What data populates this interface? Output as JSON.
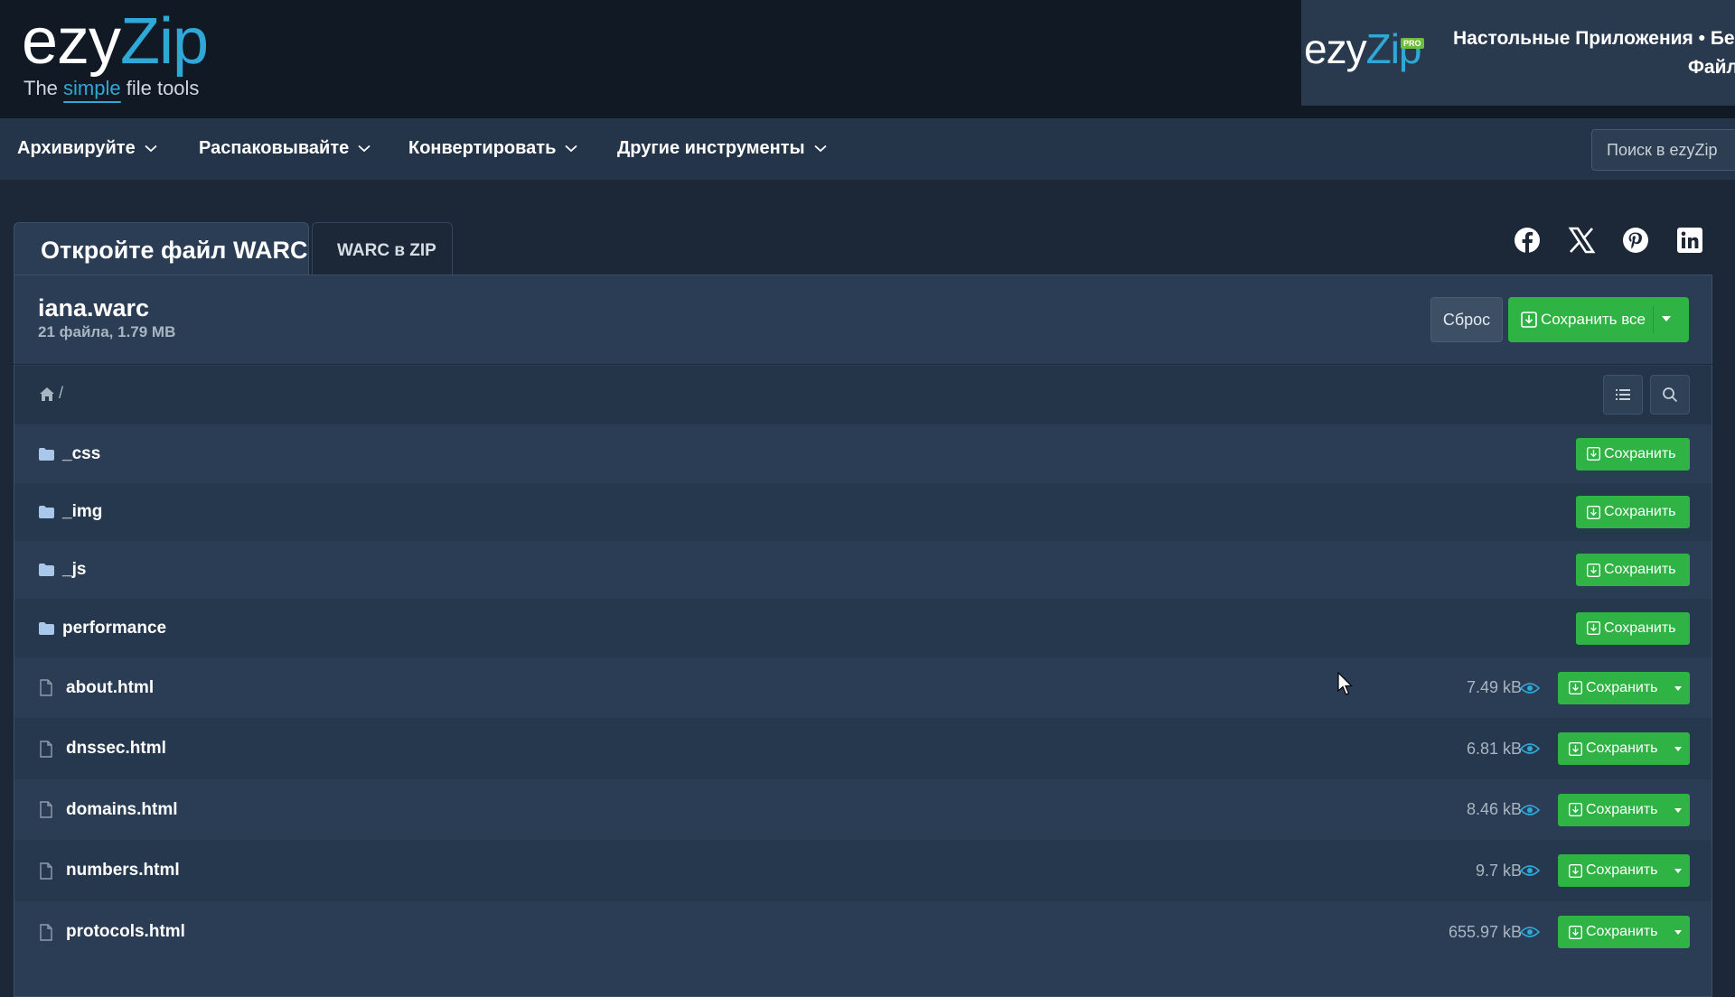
{
  "brand": {
    "logo_part1": "ezy",
    "logo_part2": "Zip",
    "tagline_before": "The ",
    "tagline_highlight": "simple",
    "tagline_after": " file tools",
    "accent_color": "#2fa8d8"
  },
  "promo": {
    "logo_part1": "ezy",
    "logo_part2": "Zip",
    "badge": "PRO",
    "line1": "Настольные Приложения • Без",
    "line2": "Файл"
  },
  "nav": {
    "items": [
      {
        "label": "Архивируйте"
      },
      {
        "label": "Распаковывайте"
      },
      {
        "label": "Конвертировать"
      },
      {
        "label": "Другие инструменты"
      }
    ],
    "search_placeholder": "Поиск в ezyZip"
  },
  "tabs": {
    "active": "Откройте файл WARC",
    "secondary": "WARC в ZIP"
  },
  "social": [
    "facebook-icon",
    "x-icon",
    "pinterest-icon",
    "linkedin-icon"
  ],
  "file": {
    "name": "iana.warc",
    "meta": "21 файла, 1.79 MB",
    "reset_label": "Сброс",
    "save_all_label": "Сохранить все"
  },
  "breadcrumb": {
    "separator": "/"
  },
  "save_label": "Сохранить",
  "folders": [
    {
      "name": "_css"
    },
    {
      "name": "_img"
    },
    {
      "name": "_js"
    },
    {
      "name": "performance"
    }
  ],
  "files": [
    {
      "name": "about.html",
      "size": "7.49 kB"
    },
    {
      "name": "dnssec.html",
      "size": "6.81 kB"
    },
    {
      "name": "domains.html",
      "size": "8.46 kB"
    },
    {
      "name": "numbers.html",
      "size": "9.7 kB"
    },
    {
      "name": "protocols.html",
      "size": "655.97 kB"
    }
  ],
  "colors": {
    "header_bg": "#111a24",
    "nav_bg": "#24354a",
    "panel_bg": "#2a3d54",
    "save_green": "#2fb344"
  }
}
